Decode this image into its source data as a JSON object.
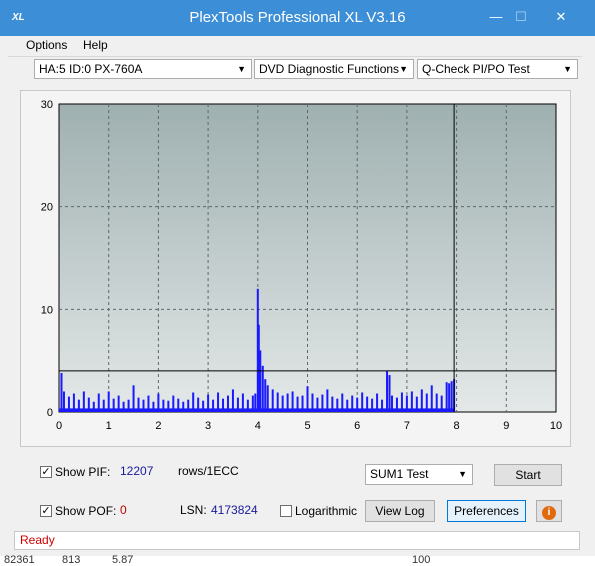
{
  "window": {
    "title": "PlexTools Professional XL V3.16",
    "icon_text": "XL"
  },
  "menu": {
    "options": "Options",
    "help": "Help"
  },
  "toolbar": {
    "drive": "HA:5 ID:0  PX-760A",
    "function": "DVD Diagnostic Functions",
    "test": "Q-Check PI/PO Test"
  },
  "chart_data": {
    "type": "bar",
    "xlim": [
      0,
      10
    ],
    "ylim": [
      0,
      30
    ],
    "x_ticks": [
      "0",
      "1",
      "2",
      "3",
      "4",
      "5",
      "6",
      "7",
      "8",
      "9",
      "10"
    ],
    "y_ticks": [
      "0",
      "10",
      "20",
      "30"
    ],
    "threshold": 4,
    "end_marker_x": 7.95,
    "grid": true,
    "series": [
      {
        "x": [
          0.05,
          0.1,
          0.2,
          0.3,
          0.4,
          0.5,
          0.6,
          0.7,
          0.8,
          0.9,
          1.0,
          1.1,
          1.2,
          1.3,
          1.4,
          1.5,
          1.6,
          1.7,
          1.8,
          1.9,
          2.0,
          2.1,
          2.2,
          2.3,
          2.4,
          2.5,
          2.6,
          2.7,
          2.8,
          2.9,
          3.0,
          3.1,
          3.2,
          3.3,
          3.4,
          3.5,
          3.6,
          3.7,
          3.8,
          3.9,
          3.95,
          4.0,
          4.02,
          4.05,
          4.1,
          4.15,
          4.2,
          4.3,
          4.4,
          4.5,
          4.6,
          4.7,
          4.8,
          4.9,
          5.0,
          5.1,
          5.2,
          5.3,
          5.4,
          5.5,
          5.6,
          5.7,
          5.8,
          5.9,
          6.0,
          6.1,
          6.2,
          6.3,
          6.4,
          6.5,
          6.6,
          6.65,
          6.7,
          6.8,
          6.9,
          7.0,
          7.1,
          7.2,
          7.3,
          7.4,
          7.5,
          7.6,
          7.7,
          7.8,
          7.85,
          7.9,
          7.95
        ],
        "values": [
          3.8,
          2,
          1.5,
          1.8,
          1.2,
          2,
          1.4,
          1,
          1.8,
          1.2,
          2,
          1.3,
          1.6,
          1,
          1.2,
          2.6,
          1.4,
          1.2,
          1.6,
          1,
          1.8,
          1.2,
          1.1,
          1.6,
          1.3,
          1,
          1.2,
          1.9,
          1.4,
          1.1,
          1.7,
          1.2,
          1.9,
          1.3,
          1.6,
          2.2,
          1.4,
          1.8,
          1.2,
          1.6,
          1.8,
          12,
          8.5,
          6,
          4.5,
          3.2,
          2.6,
          2.2,
          1.9,
          1.6,
          1.8,
          2,
          1.5,
          1.6,
          2.5,
          1.8,
          1.4,
          1.7,
          2.2,
          1.5,
          1.3,
          1.8,
          1.2,
          1.6,
          1.4,
          1.9,
          1.5,
          1.3,
          1.8,
          1.2,
          4,
          3.6,
          1.6,
          1.4,
          1.9,
          1.6,
          2,
          1.5,
          2.2,
          1.8,
          2.6,
          1.8,
          1.6,
          2.9,
          2.8,
          3,
          3.2
        ]
      }
    ]
  },
  "pif": {
    "label": "Show PIF:",
    "value": "12207",
    "unit": "rows/1ECC"
  },
  "poe": {
    "label": "Show POF:",
    "value": "0"
  },
  "lsn": {
    "label": "LSN:",
    "value": "4173824"
  },
  "log_label": "Logarithmic",
  "sum_select": "SUM1 Test",
  "buttons": {
    "start": "Start",
    "view_log": "View Log",
    "preferences": "Preferences"
  },
  "status": "Ready",
  "bottom": {
    "a": "82361",
    "b": "813",
    "c": "5.87",
    "d": "100"
  },
  "colors": {
    "titlebar": "#3c8fd6",
    "plot_bg": "#aab6b6",
    "series": "#1a1aff",
    "status": "#d00000"
  }
}
